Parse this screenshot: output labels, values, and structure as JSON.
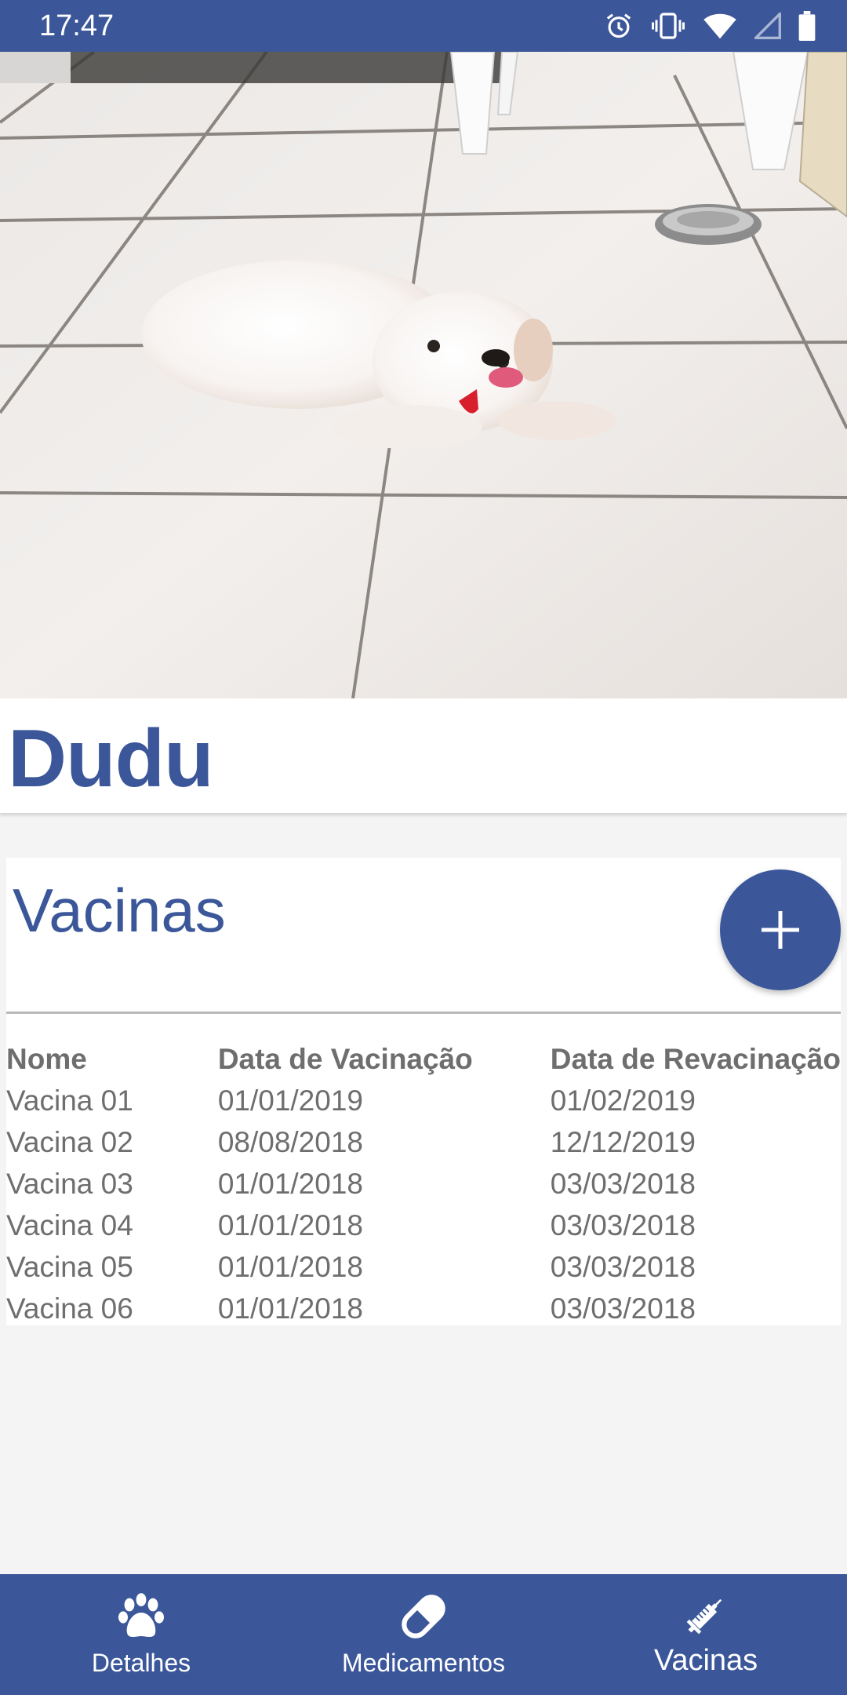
{
  "status_bar": {
    "time": "17:47",
    "icons": [
      "alarm-icon",
      "vibrate-icon",
      "wifi-icon",
      "signal-icon",
      "battery-icon"
    ]
  },
  "pet": {
    "name": "Dudu",
    "photo_icon": "pet-photo"
  },
  "vaccines": {
    "title": "Vacinas",
    "add_button_icon": "plus-icon",
    "columns": [
      "Nome",
      "Data de Vacinação",
      "Data de Revacinação"
    ],
    "rows": [
      [
        "Vacina 01",
        "01/01/2019",
        "01/02/2019"
      ],
      [
        "Vacina 02",
        "08/08/2018",
        "12/12/2019"
      ],
      [
        "Vacina 03",
        "01/01/2018",
        "03/03/2018"
      ],
      [
        "Vacina 04",
        "01/01/2018",
        "03/03/2018"
      ],
      [
        "Vacina 05",
        "01/01/2018",
        "03/03/2018"
      ],
      [
        "Vacina 06",
        "01/01/2018",
        "03/03/2018"
      ]
    ]
  },
  "bottom_nav": {
    "items": [
      {
        "label": "Detalhes",
        "icon": "paw-icon"
      },
      {
        "label": "Medicamentos",
        "icon": "pill-icon"
      },
      {
        "label": "Vacinas",
        "icon": "syringe-icon",
        "active": true
      }
    ]
  },
  "colors": {
    "primary": "#3b579a",
    "background": "#f4f4f4",
    "text_muted": "#6e6e6e"
  }
}
